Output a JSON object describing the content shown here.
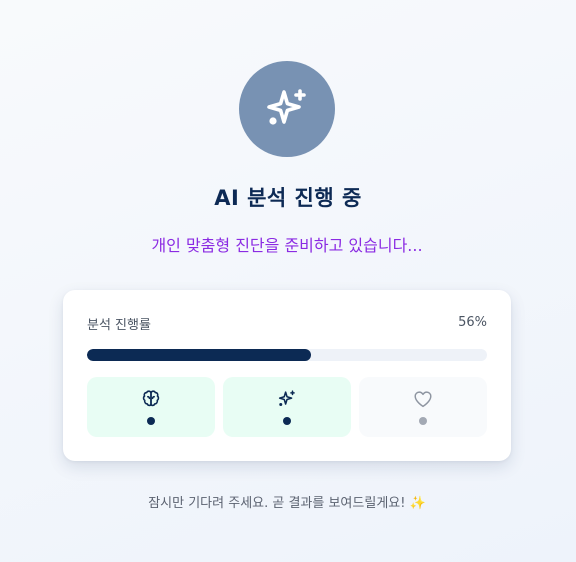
{
  "hero": {
    "icon": "sparkles-icon",
    "circle_color": "#7892b3"
  },
  "title": "AI 분석 진행 중",
  "subtitle": "개인 맞춤형 진단을 준비하고 있습니다...",
  "progress": {
    "label": "분석 진행률",
    "value_text": "56%",
    "value": 0.56,
    "fill_color": "#0c2a54"
  },
  "steps": [
    {
      "icon": "brain-icon",
      "status": "active"
    },
    {
      "icon": "sparkles-icon",
      "status": "active"
    },
    {
      "icon": "heart-icon",
      "status": "pending"
    }
  ],
  "footer": "잠시만 기다려 주세요. 곧 결과를 보여드릴게요! ✨"
}
